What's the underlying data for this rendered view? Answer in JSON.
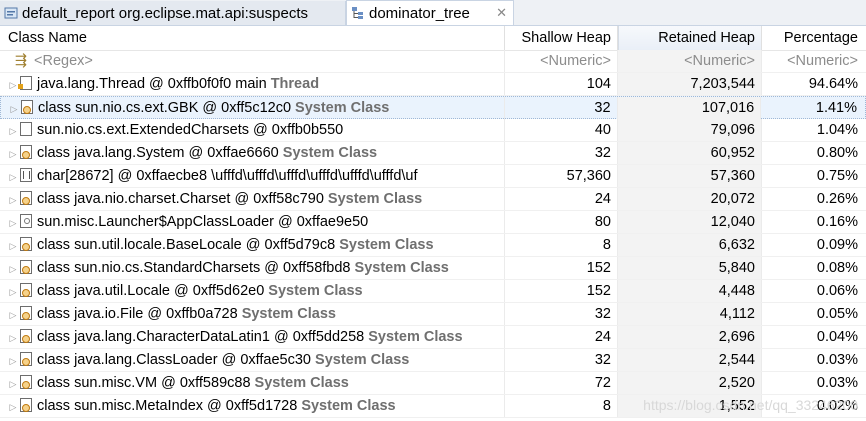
{
  "tabs": [
    {
      "label": "default_report  org.eclipse.mat.api:suspects",
      "icon": "report-icon",
      "active": false
    },
    {
      "label": "dominator_tree",
      "icon": "tree-icon",
      "active": true,
      "close": "✕"
    }
  ],
  "columns": [
    "Class Name",
    "Shallow Heap",
    "Retained Heap",
    "Percentage"
  ],
  "filter_row": {
    "name": "<Regex>",
    "shallow": "<Numeric>",
    "retained": "<Numeric>",
    "percent": "<Numeric>"
  },
  "rows": [
    {
      "name": "java.lang.Thread @ 0xffb0f0f0  main",
      "tag": "Thread",
      "icon": "thread-icon",
      "shallow": "104",
      "retained": "7,203,544",
      "percent": "94.64%"
    },
    {
      "name": "class sun.nio.cs.ext.GBK @ 0xff5c12c0",
      "tag": "System Class",
      "icon": "class-icon",
      "shallow": "32",
      "retained": "107,016",
      "percent": "1.41%",
      "selected": true
    },
    {
      "name": "sun.nio.cs.ext.ExtendedCharsets @ 0xffb0b550",
      "tag": "",
      "icon": "object-icon",
      "shallow": "40",
      "retained": "79,096",
      "percent": "1.04%"
    },
    {
      "name": "class java.lang.System @ 0xffae6660",
      "tag": "System Class",
      "icon": "class-icon",
      "shallow": "32",
      "retained": "60,952",
      "percent": "0.80%"
    },
    {
      "name": "char[28672] @ 0xffaecbe8  \\ufffd\\ufffd\\ufffd\\ufffd\\ufffd\\ufffd\\uf",
      "tag": "",
      "icon": "array-icon",
      "shallow": "57,360",
      "retained": "57,360",
      "percent": "0.75%"
    },
    {
      "name": "class java.nio.charset.Charset @ 0xff58c790",
      "tag": "System Class",
      "icon": "class-icon",
      "shallow": "24",
      "retained": "20,072",
      "percent": "0.26%"
    },
    {
      "name": "sun.misc.Launcher$AppClassLoader @ 0xffae9e50",
      "tag": "",
      "icon": "classloader-icon",
      "shallow": "80",
      "retained": "12,040",
      "percent": "0.16%"
    },
    {
      "name": "class sun.util.locale.BaseLocale @ 0xff5d79c8",
      "tag": "System Class",
      "icon": "class-icon",
      "shallow": "8",
      "retained": "6,632",
      "percent": "0.09%"
    },
    {
      "name": "class sun.nio.cs.StandardCharsets @ 0xff58fbd8",
      "tag": "System Class",
      "icon": "class-icon",
      "shallow": "152",
      "retained": "5,840",
      "percent": "0.08%"
    },
    {
      "name": "class java.util.Locale @ 0xff5d62e0",
      "tag": "System Class",
      "icon": "class-icon",
      "shallow": "152",
      "retained": "4,448",
      "percent": "0.06%"
    },
    {
      "name": "class java.io.File @ 0xffb0a728",
      "tag": "System Class",
      "icon": "class-icon",
      "shallow": "32",
      "retained": "4,112",
      "percent": "0.05%"
    },
    {
      "name": "class java.lang.CharacterDataLatin1 @ 0xff5dd258",
      "tag": "System Class",
      "icon": "class-icon",
      "shallow": "24",
      "retained": "2,696",
      "percent": "0.04%"
    },
    {
      "name": "class java.lang.ClassLoader @ 0xffae5c30",
      "tag": "System Class",
      "icon": "class-icon",
      "shallow": "32",
      "retained": "2,544",
      "percent": "0.03%"
    },
    {
      "name": "class sun.misc.VM @ 0xff589c88",
      "tag": "System Class",
      "icon": "class-icon",
      "shallow": "72",
      "retained": "2,520",
      "percent": "0.03%"
    },
    {
      "name": "class sun.misc.MetaIndex @ 0xff5d1728",
      "tag": "System Class",
      "icon": "class-icon",
      "shallow": "8",
      "retained": "1,552",
      "percent": "0.02%"
    }
  ],
  "watermark": "https://blog.csdn.net/qq_33246200"
}
